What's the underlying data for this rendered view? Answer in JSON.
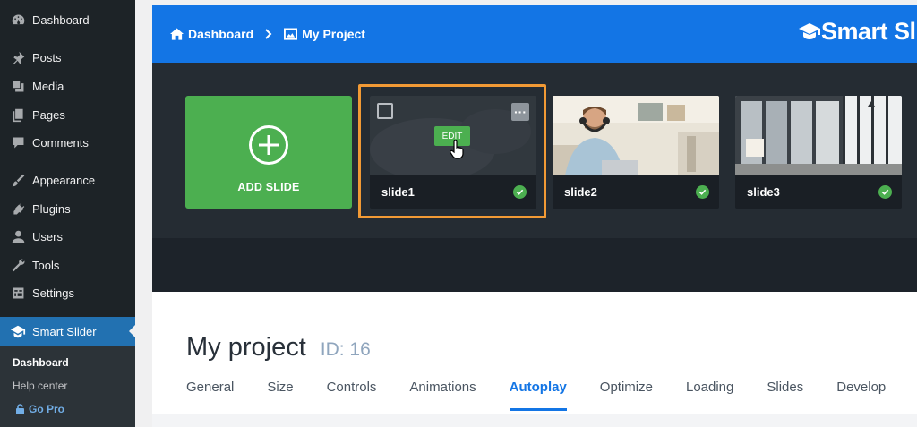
{
  "wp_menu": {
    "items": [
      {
        "label": "Dashboard",
        "icon": "dashboard-icon"
      },
      {
        "label": "Posts",
        "icon": "pin-icon"
      },
      {
        "label": "Media",
        "icon": "media-icon"
      },
      {
        "label": "Pages",
        "icon": "pages-icon"
      },
      {
        "label": "Comments",
        "icon": "comment-icon"
      },
      {
        "label": "Appearance",
        "icon": "brush-icon"
      },
      {
        "label": "Plugins",
        "icon": "plug-icon"
      },
      {
        "label": "Users",
        "icon": "user-icon"
      },
      {
        "label": "Tools",
        "icon": "wrench-icon"
      },
      {
        "label": "Settings",
        "icon": "settings-icon"
      }
    ],
    "active": {
      "label": "Smart Slider",
      "icon": "graduation-cap-icon"
    },
    "submenu": {
      "dashboard": "Dashboard",
      "help_center": "Help center",
      "go_pro": "Go Pro"
    }
  },
  "header": {
    "crumb_home": "Dashboard",
    "crumb_project": "My Project",
    "logo_text": "Smart Slid"
  },
  "slides": {
    "add_label": "ADD SLIDE",
    "edit_label": "EDIT",
    "items": [
      {
        "name": "slide1"
      },
      {
        "name": "slide2"
      },
      {
        "name": "slide3"
      }
    ]
  },
  "project": {
    "title": "My project",
    "id_label": "ID: 16"
  },
  "tabs": [
    "General",
    "Size",
    "Controls",
    "Animations",
    "Autoplay",
    "Optimize",
    "Loading",
    "Slides",
    "Develop"
  ],
  "active_tab": "Autoplay",
  "colors": {
    "accent": "#1375e5",
    "wp_sidebar": "#1d2327",
    "wp_active": "#2271b1",
    "add_green": "#4caf50",
    "highlight_orange": "#f29a35"
  }
}
